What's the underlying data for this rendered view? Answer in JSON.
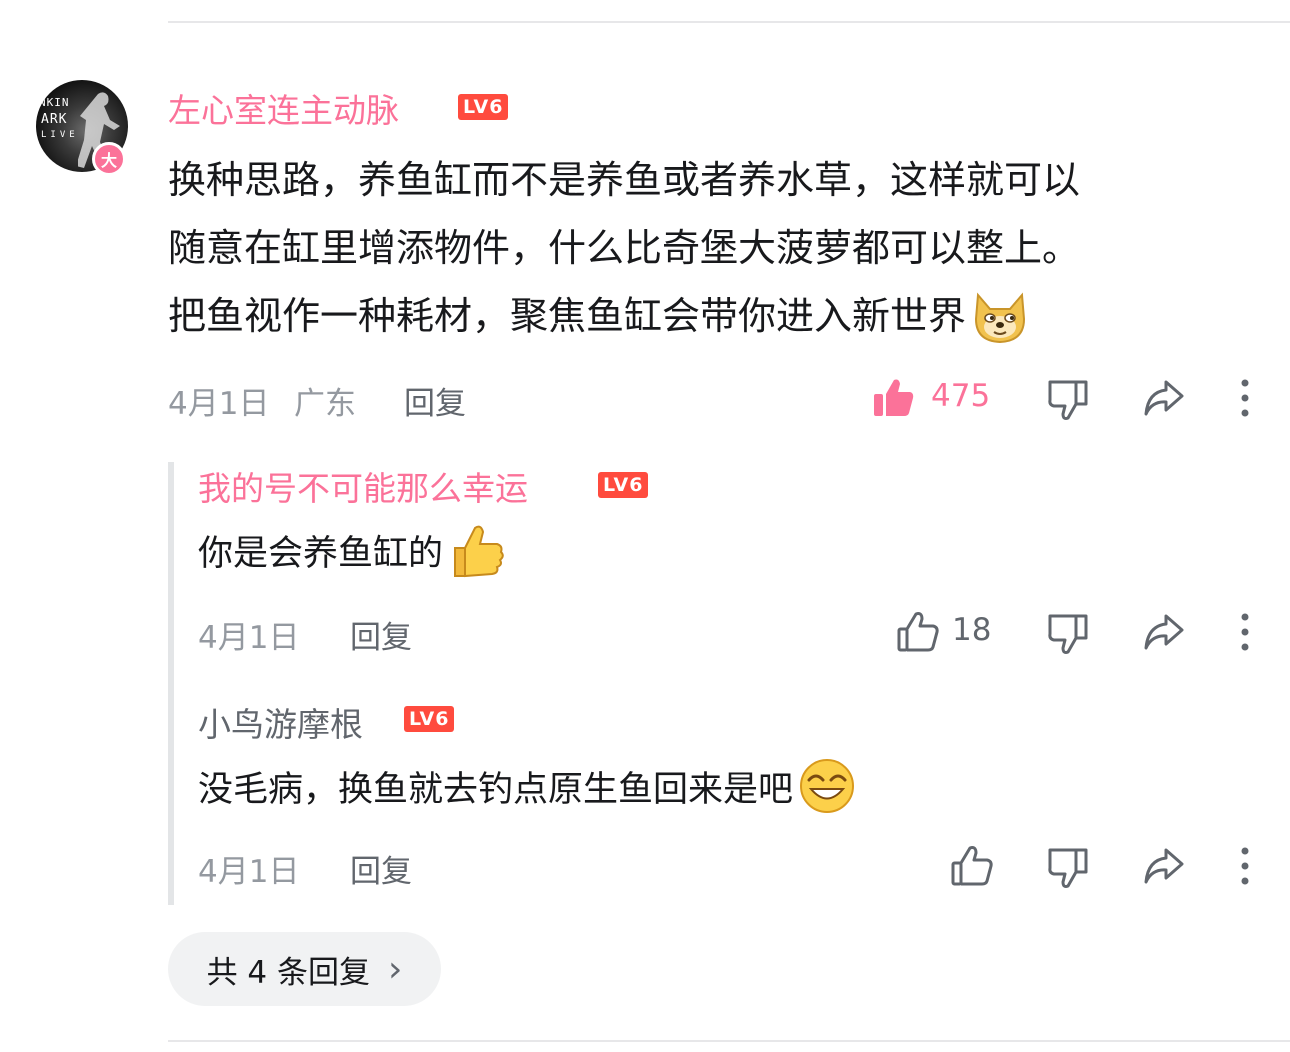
{
  "main_comment": {
    "username": "左心室连主动脉",
    "level": "LV6",
    "avatar_badge": "大",
    "avatar_text": [
      "NKIN",
      "ARK",
      "LIVE"
    ],
    "content_lines": [
      "换种思路，养鱼缸而不是养鱼或者养水草，这样就可以",
      "随意在缸里增添物件，什么比奇堡大菠萝都可以整上。",
      "把鱼视作一种耗材，聚焦鱼缸会带你进入新世界"
    ],
    "date": "4月1日",
    "location": "广东",
    "reply_label": "回复",
    "like_count": "475",
    "emoji": "doge-emoji"
  },
  "replies": [
    {
      "username": "我的号不可能那么幸运",
      "level": "LV6",
      "content": "你是会养鱼缸的",
      "date": "4月1日",
      "reply_label": "回复",
      "like_count": "18",
      "emoji": "thumbs-up-emoji"
    },
    {
      "username": "小鸟游摩根",
      "level": "LV6",
      "content": "没毛病，换鱼就去钓点原生鱼回来是吧",
      "date": "4月1日",
      "reply_label": "回复",
      "like_count": "",
      "emoji": "grin-emoji"
    }
  ],
  "more_replies": {
    "label": "共 4 条回复",
    "chevron": "›"
  },
  "colors": {
    "accent_pink": "#fb7299",
    "level_badge": "#ff4b3e",
    "meta_grey": "#9499a0",
    "text_dark": "#18191c"
  }
}
